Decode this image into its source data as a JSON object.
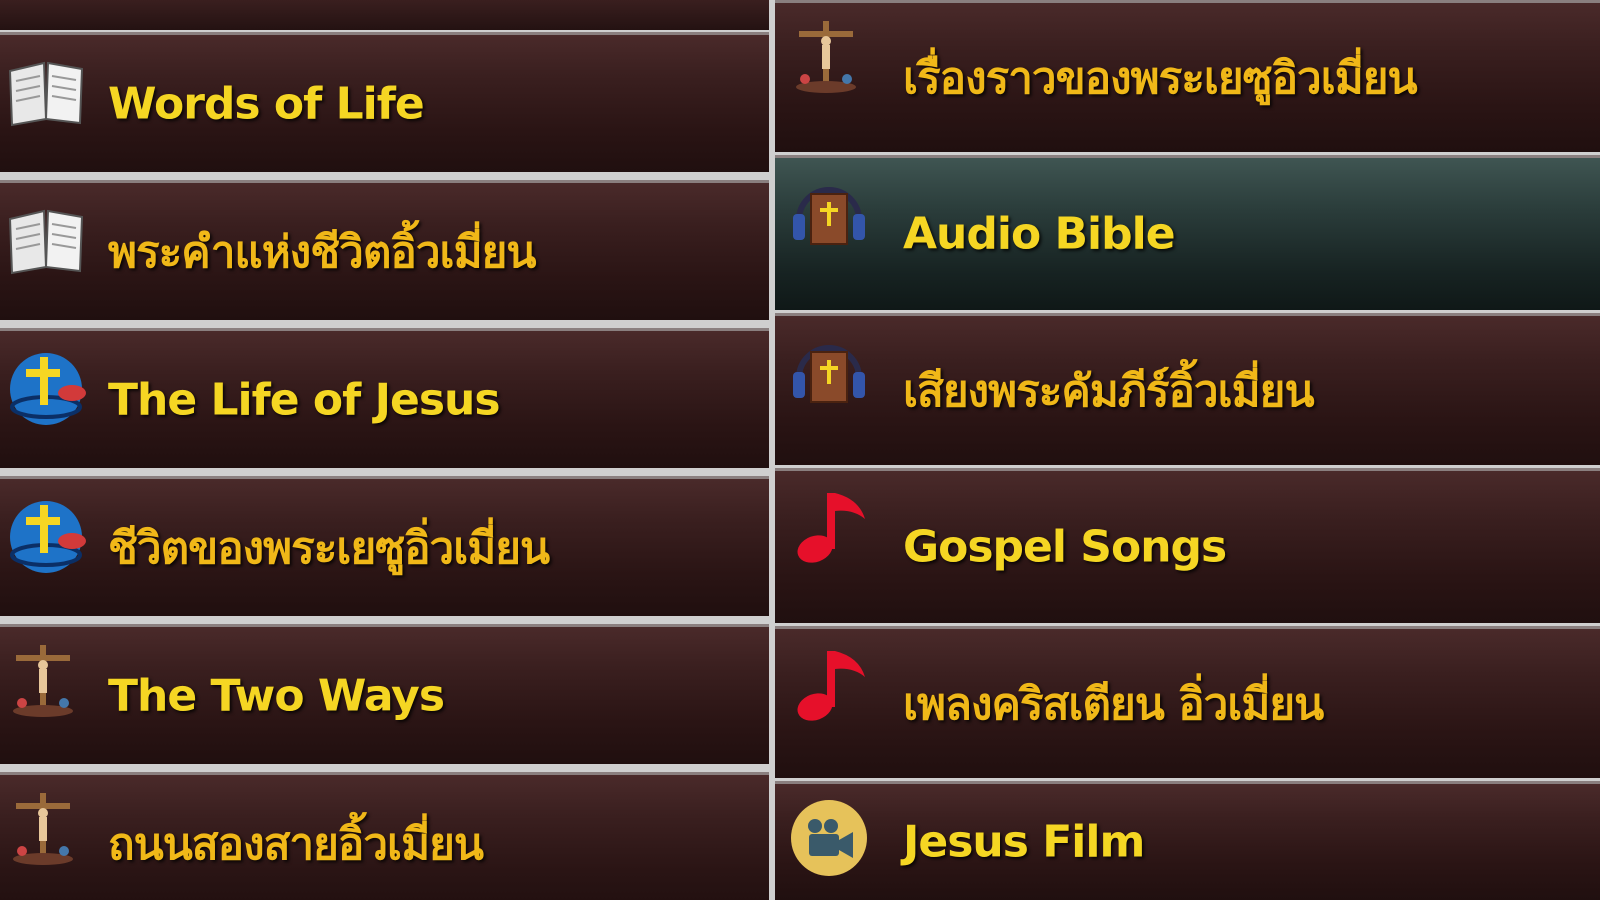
{
  "left_column": [
    {
      "label": "Words of Life",
      "icon": "open-book-icon"
    },
    {
      "label": "พระคำแห่งชีวิตอิ้วเมี่ยน",
      "icon": "open-book-icon"
    },
    {
      "label": "The Life of Jesus",
      "icon": "cross-globe-icon"
    },
    {
      "label": "ชีวิตของพระเยซูอิ่วเมี่ยน",
      "icon": "cross-globe-icon"
    },
    {
      "label": "The Two Ways",
      "icon": "crucifix-icon"
    },
    {
      "label": "ถนนสองสายอิ้วเมี่ยน",
      "icon": "crucifix-icon"
    }
  ],
  "right_column": [
    {
      "label": "เรื่องราวของพระเยซูอิวเมี่ยน",
      "icon": "crucifix-icon"
    },
    {
      "label": "Audio Bible",
      "icon": "headphones-bible-icon",
      "selected": true
    },
    {
      "label": "เสียงพระคัมภีร์อิ้วเมี่ยน",
      "icon": "headphones-bible-icon"
    },
    {
      "label": "Gospel Songs",
      "icon": "music-note-icon"
    },
    {
      "label": "เพลงคริสเตียน อิ่วเมี่ยน",
      "icon": "music-note-icon"
    },
    {
      "label": "Jesus Film",
      "icon": "film-camera-icon"
    }
  ],
  "colors": {
    "label_english": "#f5d623",
    "label_thai": "#f0b818",
    "row_bg": "#2a1414",
    "selected_bg": "#172322"
  }
}
